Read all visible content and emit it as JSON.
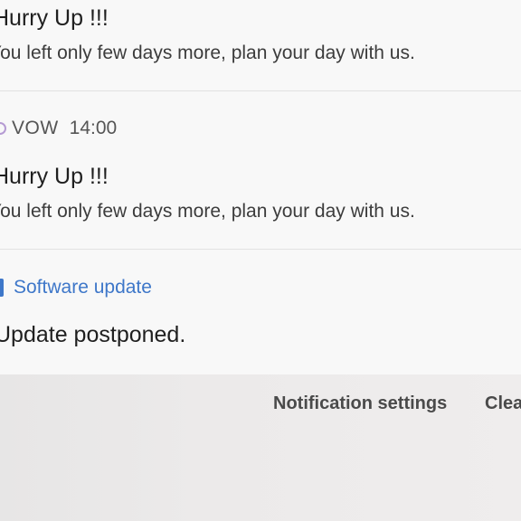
{
  "notifications": [
    {
      "title": "Hurry Up !!!",
      "body": "You left only few days more, plan your day with us."
    },
    {
      "app": "VOW",
      "time": "14:00",
      "title": "Hurry Up !!!",
      "body": "You left only few days more, plan your day with us."
    }
  ],
  "software_update": {
    "app": "Software update",
    "text": "Update postponed.",
    "accent": "#3e77c9",
    "icon": "software-update-icon"
  },
  "actions": {
    "settings": "Notification settings",
    "clear": "Clear"
  }
}
